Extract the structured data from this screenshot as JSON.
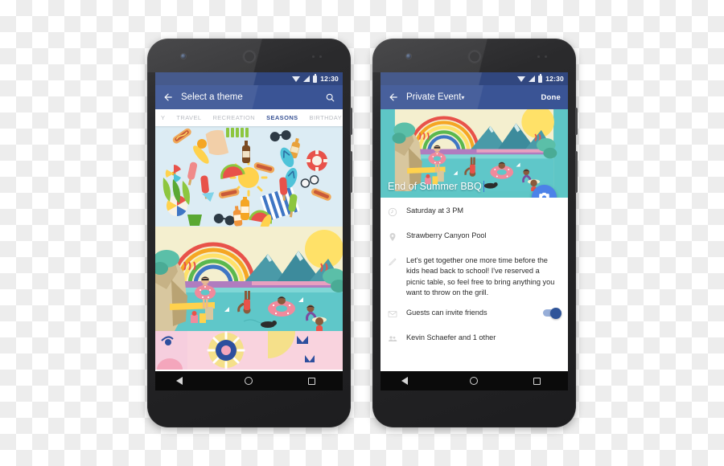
{
  "statusbar": {
    "time": "12:30",
    "icons": [
      "wifi-icon",
      "signal-icon",
      "battery-icon"
    ]
  },
  "phone_left": {
    "toolbar": {
      "back_icon": "back-arrow-icon",
      "title": "Select a theme",
      "search_icon": "search-icon"
    },
    "tabs": [
      {
        "label": "Y",
        "active": false
      },
      {
        "label": "TRAVEL",
        "active": false
      },
      {
        "label": "RECREATION",
        "active": false
      },
      {
        "label": "SEASONS",
        "active": true
      },
      {
        "label": "BIRTHDAY",
        "active": false
      }
    ],
    "themes": [
      {
        "name": "summer-collage-theme",
        "alt": "Summer items collage on light blue"
      },
      {
        "name": "pool-scene-theme",
        "alt": "Pool party illustration with rainbow and mountains"
      },
      {
        "name": "geometric-pattern-theme",
        "alt": "Pink and yellow geometric pattern"
      }
    ]
  },
  "phone_right": {
    "toolbar": {
      "back_icon": "back-arrow-icon",
      "title": "Private Event",
      "caret": "▾",
      "done_label": "Done"
    },
    "hero": {
      "event_title": "End of Summer BBQ",
      "camera_fab": "camera-icon"
    },
    "details": [
      {
        "icon": "clock-icon",
        "text": "Saturday at 3 PM"
      },
      {
        "icon": "location-icon",
        "text": "Strawberry Canyon Pool"
      },
      {
        "icon": "pencil-icon",
        "text": "Let's get together one more time before the kids head back to school! I've reserved a picnic table, so feel free to bring anything you want to throw on the grill."
      },
      {
        "icon": "mail-icon",
        "text": "Guests can invite friends",
        "toggle": true
      },
      {
        "icon": "people-icon",
        "text": "Kevin Schaefer and 1 other"
      }
    ]
  },
  "navbar": {
    "back": "nav-back-icon",
    "home": "nav-home-icon",
    "recents": "nav-recents-icon"
  },
  "colors": {
    "statusbar": "#31477f",
    "toolbar": "#3a5495",
    "accent": "#3a5495",
    "fab": "#4c82e8",
    "toggle_on": "#2f5499",
    "bezel": "#242426"
  }
}
